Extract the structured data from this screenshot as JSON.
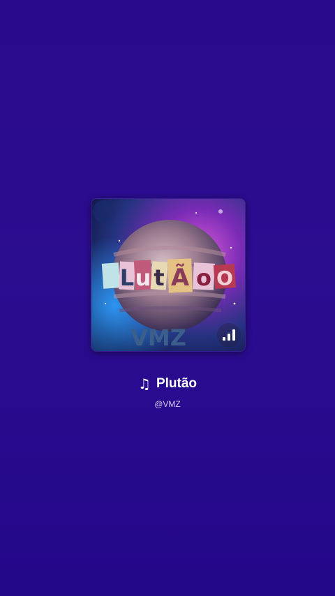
{
  "song": {
    "title": "Plutão",
    "artist": "@VMZ",
    "note_icon": "♫"
  },
  "cover": {
    "logo_text": "PLUTÃO",
    "signature": "VMZ",
    "badge_icon": "signal-bars-icon",
    "logo_colors": [
      "#bfe3e6",
      "#e8c2d6",
      "#c05a7a",
      "#e7d9b4",
      "#e6c184",
      "#b73a52"
    ]
  },
  "colors": {
    "background": "#2a0a8c",
    "title": "#ffffff",
    "artist": "#d6cdf0"
  }
}
